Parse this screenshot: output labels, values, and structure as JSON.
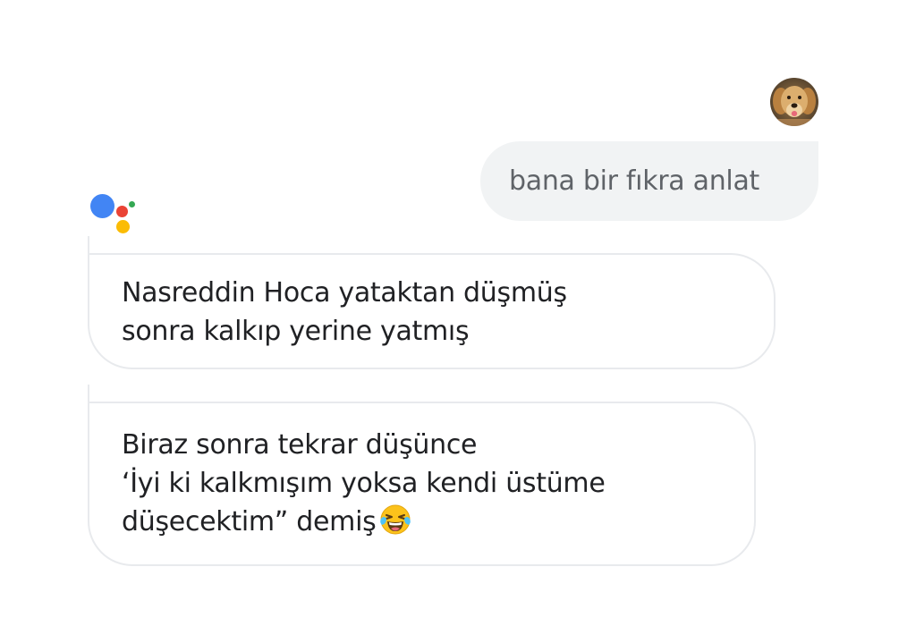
{
  "user": {
    "avatar_icon": "dog-avatar-icon",
    "message": "bana bir fıkra anlat"
  },
  "assistant": {
    "logo_icon": "google-assistant-icon",
    "logo_colors": {
      "blue": "#4285f4",
      "red": "#ea4335",
      "yellow": "#fbbc05",
      "green": "#34a853"
    },
    "messages": [
      {
        "lines": [
          "Nasreddin Hoca yataktan düşmüş",
          "sonra kalkıp yerine yatmış"
        ]
      },
      {
        "lines": [
          "Biraz sonra tekrar düşünce",
          "‘İyi ki kalkmışım yoksa kendi üstüme",
          "düşecektim” demiş"
        ],
        "trailing_emoji_icon": "tears-of-joy-emoji-icon"
      }
    ]
  },
  "colors": {
    "user_bubble_bg": "#f1f3f4",
    "user_text": "#5f6368",
    "assistant_text": "#202124",
    "assistant_border": "#e8eaed"
  }
}
